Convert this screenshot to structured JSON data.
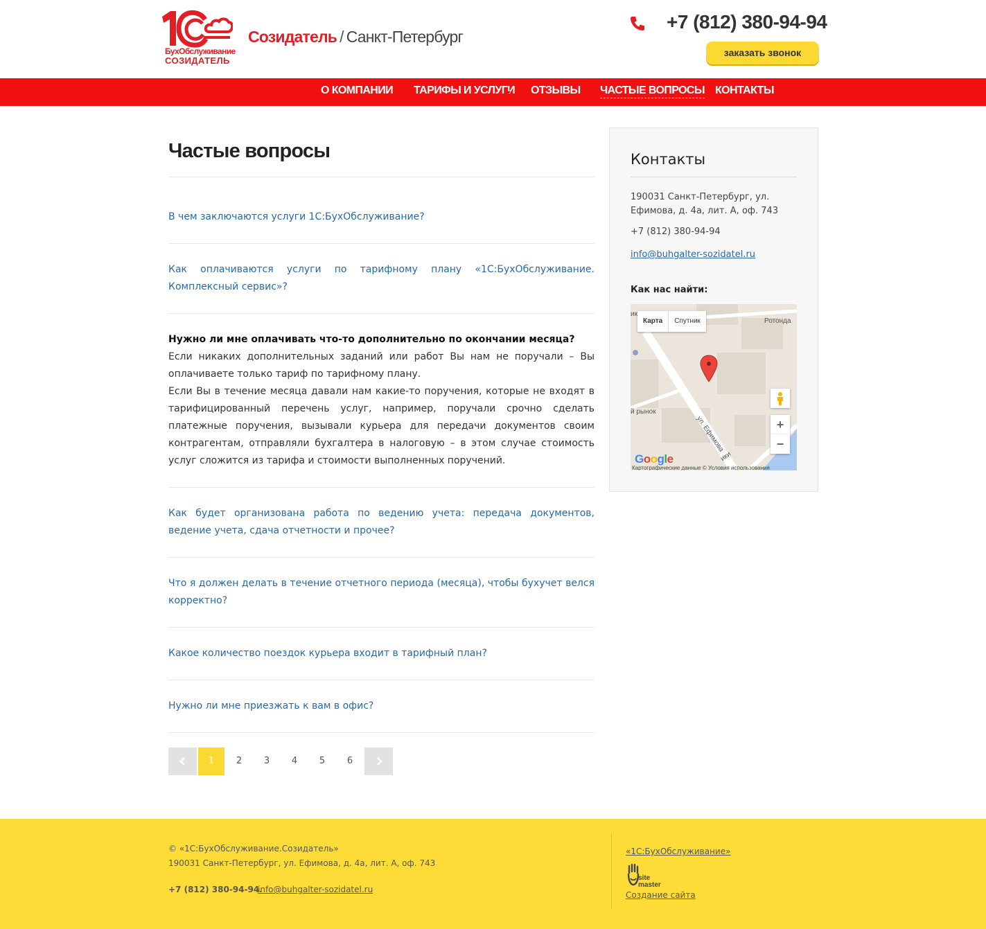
{
  "header": {
    "logo_line1": "БухОбслуживание",
    "logo_line2": "СОЗИДАТЕЛЬ",
    "brand_name": "Созидатель",
    "brand_sep": "/",
    "brand_city": "Санкт-Петербург",
    "phone": "+7 (812) 380-94-94",
    "callback_button": "заказать звонок"
  },
  "nav": {
    "items": [
      "О КОМПАНИИ",
      "ТАРИФЫ И УСЛУГИ",
      "ОТЗЫВЫ",
      "ЧАСТЫЕ ВОПРОСЫ",
      "КОНТАКТЫ"
    ],
    "active": "ЧАСТЫЕ ВОПРОСЫ"
  },
  "main": {
    "title": "Частые вопросы",
    "faq": [
      {
        "question": "В чем заключаются услуги 1С:БухОбслуживание?"
      },
      {
        "question": "Как оплачиваются услуги по тарифному плану «1С:БухОбслуживание. Комплексный сервис»?"
      },
      {
        "question": "Нужно ли мне оплачивать что-то дополнительно по окончании месяца?",
        "expanded": true,
        "answer_p1": "Если никаких дополнительных заданий или работ Вы нам не поручали –  Вы оплачиваете только тариф по тарифному плану.",
        "answer_p2": "Если Вы в течение месяца давали нам какие-то поручения, которые не входят в тарифицированный перечень услуг, например, поручали срочно сделать платежные поручения, вызывали курьера для передачи документов своим контрагентам, отправляли бухгалтера в налоговую –  в этом случае стоимость услуг сложится из тарифа и стоимости выполненных поручений."
      },
      {
        "question": "Как будет организована работа по ведению учета: передача документов, ведение учета, сдача отчетности и прочее?"
      },
      {
        "question": "Что я должен делать в течение отчетного периода (месяца), чтобы бухучет велся корректно?"
      },
      {
        "question": "Какое количество поездок курьера входит в тарифный план?"
      },
      {
        "question": "Нужно ли мне приезжать к вам в офис?"
      }
    ],
    "pagination": {
      "pages": [
        "1",
        "2",
        "3",
        "4",
        "5",
        "6"
      ],
      "current": "1"
    }
  },
  "sidebar": {
    "title": "Контакты",
    "address": "190031 Санкт-Петербург, ул. Ефимова, д. 4а, лит. А, оф. 743",
    "phone": "+7 (812) 380-94-94",
    "email": "info@buhgalter-sozidatel.ru",
    "find_us": "Как нас найти:",
    "map": {
      "btn_map": "Карта",
      "btn_satellite": "Спутник",
      "label_rotonda": "Ротонда",
      "label_market": "й рынок",
      "label_street": "ул. Ефимова",
      "label_partial1": "ик",
      "label_partial2": "ики",
      "zoom_in": "+",
      "zoom_out": "−",
      "google": "Google",
      "footer": "Картографические данные © Условия использования"
    }
  },
  "footer": {
    "copyright": "© «1С:БухОбслуживание.Созидатель»",
    "address": "190031 Санкт-Петербург, ул. Ефимова, д. 4а, лит. А, оф. 743",
    "phone": "+7 (812) 380-94-94.",
    "email": "info@buhgalter-sozidatel.ru",
    "link_1c": "«1С:БухОбслуживание»",
    "sitemaster_line1": "site",
    "sitemaster_line2": "master",
    "site_creation": "Создание сайта"
  },
  "colors": {
    "red": "#f01010",
    "yellow": "#fcd832",
    "footer_yellow": "#fddc38",
    "link_blue": "#2969a8"
  }
}
